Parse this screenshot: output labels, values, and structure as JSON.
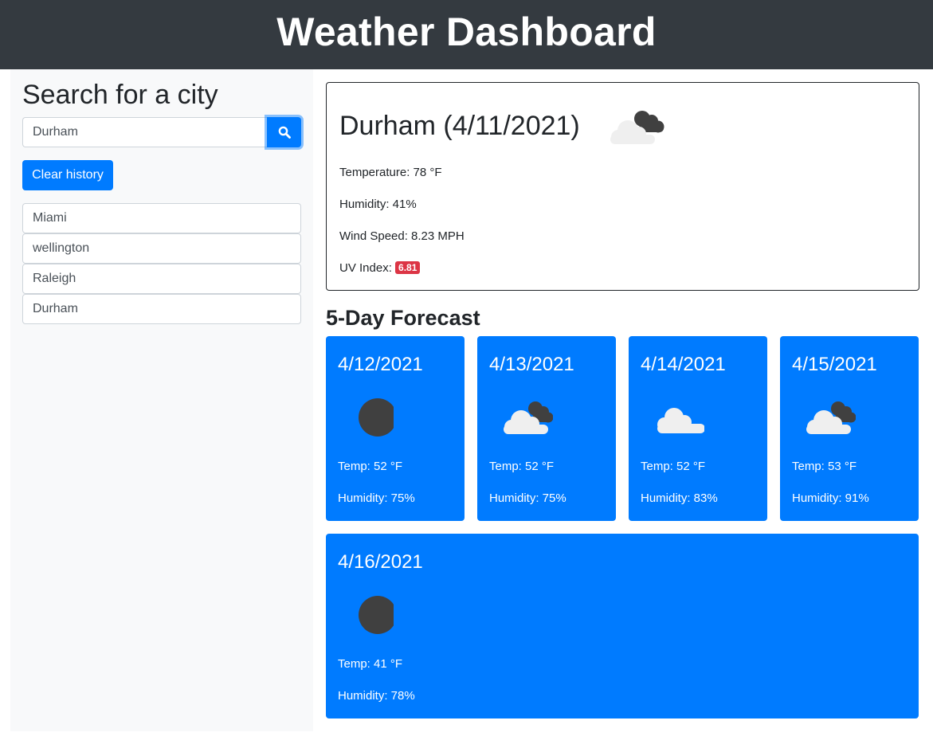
{
  "header": {
    "title": "Weather Dashboard"
  },
  "sidebar": {
    "title": "Search for a city",
    "search": {
      "value": "Durham",
      "placeholder": ""
    },
    "search_icon": "search-icon",
    "clear_label": "Clear history",
    "history": [
      "Miami",
      "wellington",
      "Raleigh",
      "Durham"
    ]
  },
  "current": {
    "title": "Durham (4/11/2021)",
    "icon": "broken-clouds-icon",
    "temperature": "Temperature: 78 °F",
    "humidity": "Humidity: 41%",
    "wind": "Wind Speed: 8.23 MPH",
    "uv_label": "UV Index: ",
    "uv_value": "6.81",
    "uv_color": "#dc3545"
  },
  "forecast": {
    "heading": "5-Day Forecast",
    "accent": "#007bff",
    "days": [
      {
        "date": "4/12/2021",
        "icon": "clear-night-icon",
        "temp": "Temp: 52 °F",
        "humidity": "Humidity: 75%"
      },
      {
        "date": "4/13/2021",
        "icon": "broken-clouds-icon",
        "temp": "Temp: 52 °F",
        "humidity": "Humidity: 75%"
      },
      {
        "date": "4/14/2021",
        "icon": "scattered-clouds-icon",
        "temp": "Temp: 52 °F",
        "humidity": "Humidity: 83%"
      },
      {
        "date": "4/15/2021",
        "icon": "broken-clouds-icon",
        "temp": "Temp: 53 °F",
        "humidity": "Humidity: 91%"
      },
      {
        "date": "4/16/2021",
        "icon": "clear-night-icon",
        "temp": "Temp: 41 °F",
        "humidity": "Humidity: 78%"
      }
    ]
  }
}
